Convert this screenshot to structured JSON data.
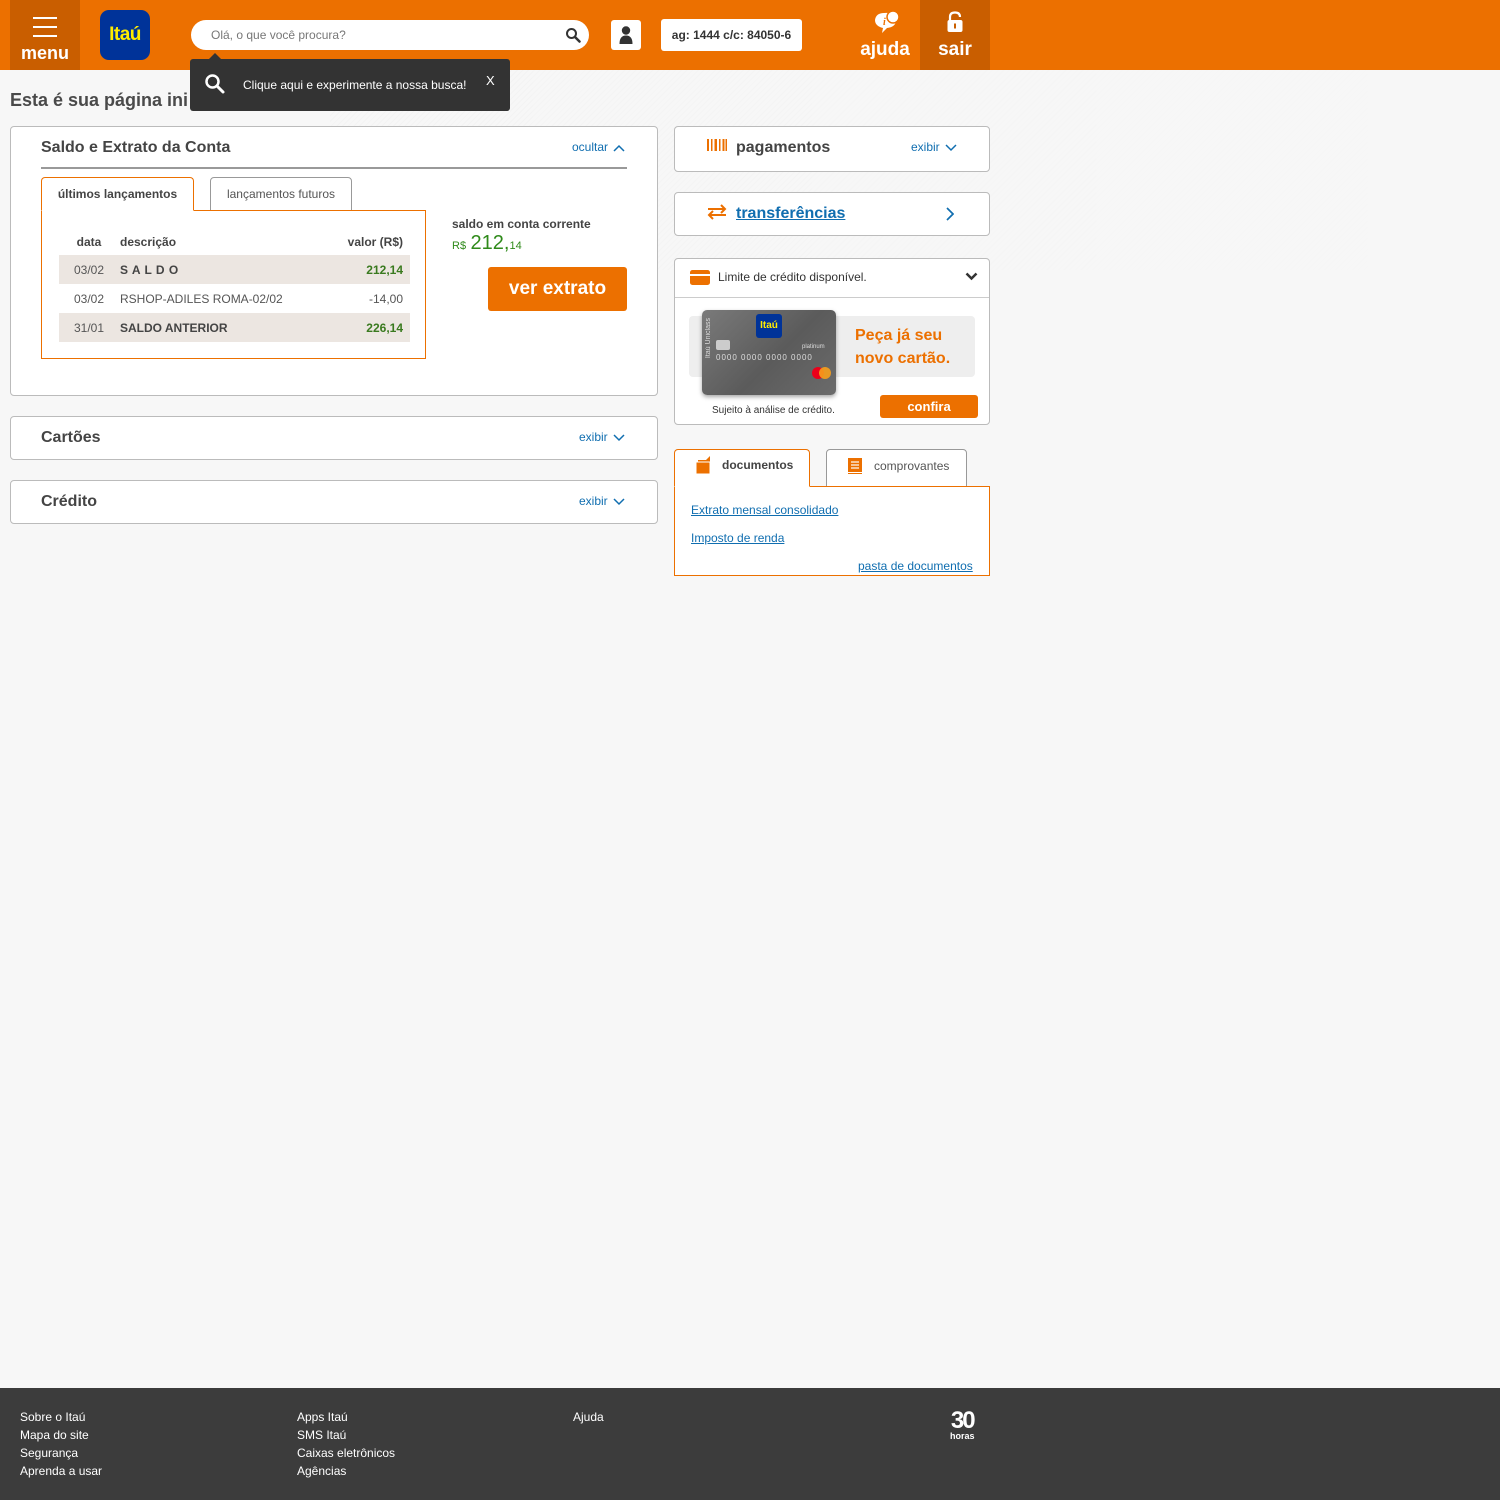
{
  "header": {
    "menu_label": "menu",
    "logo_text": "Itaú",
    "search_placeholder": "Olá, o que você procura?",
    "account_info": "ag: 1444 c/c: 84050-6",
    "help_label": "ajuda",
    "exit_label": "sair",
    "brand_color": "#ec7000"
  },
  "tooltip": {
    "text": "Clique aqui e experimente a nossa busca!",
    "close_label": "X"
  },
  "page_title": "Esta é sua página ini",
  "account_panel": {
    "title": "Saldo e Extrato da Conta",
    "toggle_label": "ocultar",
    "tabs": [
      {
        "label": "últimos lançamentos",
        "active": true
      },
      {
        "label": "lançamentos futuros",
        "active": false
      }
    ],
    "columns": {
      "date": "data",
      "description": "descrição",
      "value": "valor (R$)"
    },
    "rows": [
      {
        "date": "03/02",
        "description": "S A L D O",
        "value": "212,14"
      },
      {
        "date": "03/02",
        "description": "RSHOP-ADILES ROMA-02/02",
        "value": "-14,00"
      },
      {
        "date": "31/01",
        "description": "SALDO ANTERIOR",
        "value": "226,14"
      }
    ],
    "balance_label": "saldo em conta corrente",
    "balance_currency": "R$",
    "balance_integer": "212,",
    "balance_cents": "14",
    "statement_button": "ver extrato"
  },
  "cards_panel": {
    "title": "Cartões",
    "toggle_label": "exibir"
  },
  "credit_panel": {
    "title": "Crédito",
    "toggle_label": "exibir"
  },
  "payments_panel": {
    "title": "pagamentos",
    "toggle_label": "exibir",
    "icon": "barcode-icon"
  },
  "transfers_panel": {
    "title": "transferências",
    "icon": "transfer-arrows-icon"
  },
  "credit_limit_panel": {
    "title": "Limite de crédito disponível.",
    "banner_line1": "Peça já seu",
    "banner_line2": "novo cartão.",
    "card_brand": "Itaú",
    "card_side_text": "Itaú Uniclass",
    "card_number": "0000 0000 0000 0000",
    "card_type": "platinum",
    "disclaimer": "Sujeito à análise de crédito.",
    "button_label": "confira"
  },
  "documents": {
    "tabs": [
      {
        "label": "documentos",
        "active": true,
        "icon": "folder-icon"
      },
      {
        "label": "comprovantes",
        "active": false,
        "icon": "receipt-icon"
      }
    ],
    "links": [
      "Extrato mensal consolidado",
      "Imposto de renda"
    ],
    "folder_link": "pasta de documentos"
  },
  "footer": {
    "col1": [
      "Sobre o Itaú",
      "Mapa do site",
      "Segurança",
      "Aprenda a usar"
    ],
    "col2": [
      "Apps Itaú",
      "SMS Itaú",
      "Caixas eletrônicos",
      "Agências"
    ],
    "col3": [
      "Ajuda"
    ],
    "logo_number": "30",
    "logo_word": "horas"
  }
}
